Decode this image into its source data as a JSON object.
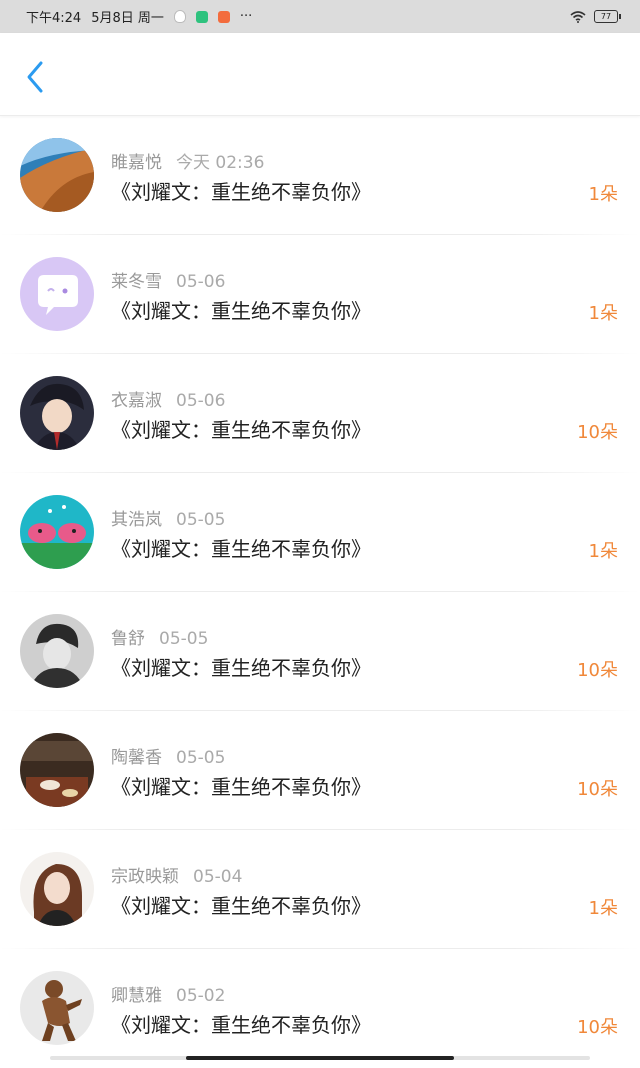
{
  "status_bar": {
    "time": "下午4:24",
    "date": "5月8日",
    "weekday": "周一",
    "more": "···",
    "battery": "77"
  },
  "items": [
    {
      "name": "睢嘉悦",
      "date": "今天 02:36",
      "book": "《刘耀文：重生绝不辜负你》",
      "count": "1朵"
    },
    {
      "name": "莱冬雪",
      "date": "05-06",
      "book": "《刘耀文：重生绝不辜负你》",
      "count": "1朵"
    },
    {
      "name": "衣嘉淑",
      "date": "05-06",
      "book": "《刘耀文：重生绝不辜负你》",
      "count": "10朵"
    },
    {
      "name": "其浩岚",
      "date": "05-05",
      "book": "《刘耀文：重生绝不辜负你》",
      "count": "1朵"
    },
    {
      "name": "鲁舒",
      "date": "05-05",
      "book": "《刘耀文：重生绝不辜负你》",
      "count": "10朵"
    },
    {
      "name": "陶馨香",
      "date": "05-05",
      "book": "《刘耀文：重生绝不辜负你》",
      "count": "10朵"
    },
    {
      "name": "宗政映颖",
      "date": "05-04",
      "book": "《刘耀文：重生绝不辜负你》",
      "count": "1朵"
    },
    {
      "name": "卿慧雅",
      "date": "05-02",
      "book": "《刘耀文：重生绝不辜负你》",
      "count": "10朵"
    }
  ],
  "colors": {
    "accent": "#2b9bf0",
    "count": "#f0883a",
    "status_bar_bg": "#dcdcdc"
  },
  "icons": [
    "qq-icon",
    "shield-icon",
    "mail-icon",
    "wifi-icon",
    "battery-icon",
    "back-arrow-icon"
  ]
}
